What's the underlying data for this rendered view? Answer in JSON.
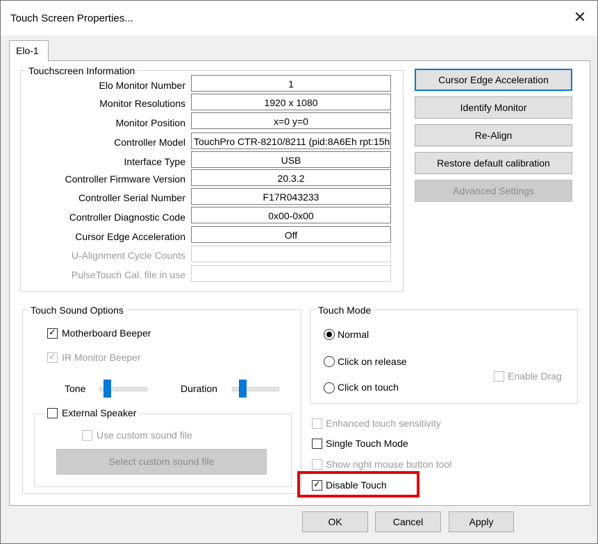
{
  "window": {
    "title": "Touch Screen Properties...",
    "close_symbol": "✕"
  },
  "tab": {
    "label": "Elo-1"
  },
  "touchscreen_info": {
    "legend": "Touchscreen Information",
    "rows": [
      {
        "label": "Elo Monitor Number",
        "value": "1"
      },
      {
        "label": "Monitor Resolutions",
        "value": "1920 x 1080"
      },
      {
        "label": "Monitor Position",
        "value": "x=0  y=0"
      },
      {
        "label": "Controller Model",
        "value": "TouchPro CTR-8210/8211 (pid:8A6Eh rpt:15h"
      },
      {
        "label": "Interface Type",
        "value": "USB"
      },
      {
        "label": "Controller Firmware Version",
        "value": "20.3.2"
      },
      {
        "label": "Controller Serial Number",
        "value": "F17R043233"
      },
      {
        "label": "Controller Diagnostic Code",
        "value": "0x00-0x00"
      },
      {
        "label": "Cursor Edge Acceleration",
        "value": "Off"
      },
      {
        "label": "U-Alignment Cycle Counts",
        "value": ""
      },
      {
        "label": "PulseTouch Cal. file in use",
        "value": ""
      }
    ]
  },
  "side_buttons": {
    "cursor_edge": "Cursor Edge Acceleration",
    "identify": "Identify Monitor",
    "realign": "Re-Align",
    "restore": "Restore default calibration",
    "advanced": "Advanced Settings"
  },
  "sound": {
    "legend": "Touch Sound Options",
    "motherboard_beeper": "Motherboard Beeper",
    "ir_beeper": "IR Monitor Beeper",
    "tone_label": "Tone",
    "duration_label": "Duration",
    "external_speaker": "External Speaker",
    "use_custom": "Use custom sound file",
    "select_custom": "Select custom sound file"
  },
  "touch_mode": {
    "legend": "Touch Mode",
    "normal": "Normal",
    "click_release": "Click on release",
    "click_touch": "Click on touch",
    "enable_drag": "Enable Drag"
  },
  "options": {
    "enhanced": "Enhanced touch sensitivity",
    "single_touch": "Single Touch Mode",
    "show_right": "Show right mouse button tool",
    "disable_touch": "Disable Touch"
  },
  "footer": {
    "ok": "OK",
    "cancel": "Cancel",
    "apply": "Apply"
  },
  "check_mark": "✓",
  "colors": {
    "highlight": "#e00000",
    "accent": "#0078d7"
  }
}
